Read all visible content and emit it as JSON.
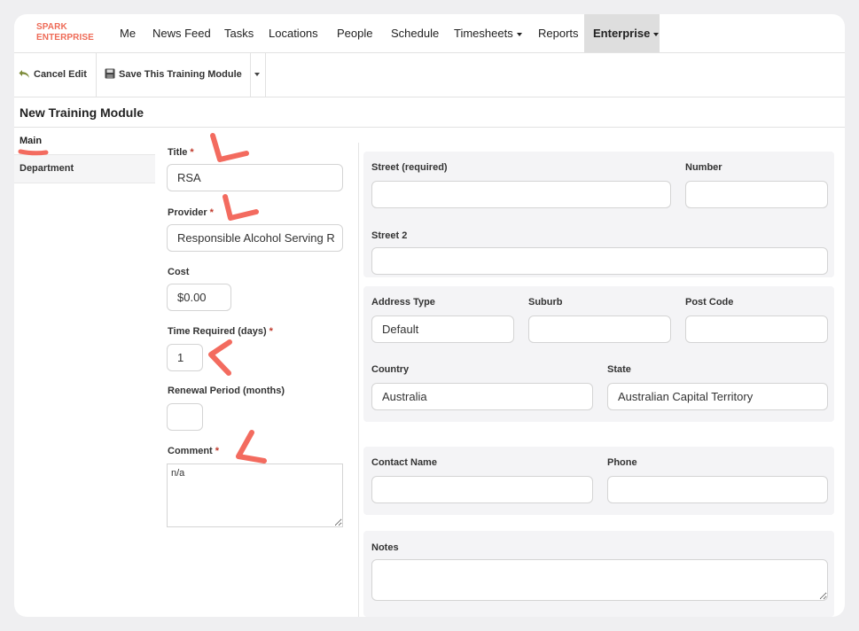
{
  "brand": {
    "line1": "SPARK",
    "line2": "ENTERPRISE"
  },
  "nav": {
    "me": "Me",
    "news_feed": "News Feed",
    "tasks": "Tasks",
    "locations": "Locations",
    "people": "People",
    "schedule": "Schedule",
    "timesheets": "Timesheets",
    "reports": "Reports",
    "enterprise": "Enterprise"
  },
  "toolbar": {
    "cancel_label": "Cancel Edit",
    "save_label": "Save This Training Module"
  },
  "page_title": "New Training Module",
  "sidebar": {
    "main": "Main",
    "department": "Department"
  },
  "form": {
    "title_label": "Title",
    "title_value": "RSA",
    "provider_label": "Provider",
    "provider_value": "Responsible Alcohol Serving R",
    "cost_label": "Cost",
    "cost_value": "$0.00",
    "time_label": "Time Required (days)",
    "time_value": "1",
    "renewal_label": "Renewal Period (months)",
    "renewal_value": "",
    "comment_label": "Comment",
    "comment_value": "n/a",
    "required_mark": "*"
  },
  "address": {
    "street_label": "Street (required)",
    "number_label": "Number",
    "street2_label": "Street 2",
    "address_type_label": "Address Type",
    "address_type_value": "Default",
    "suburb_label": "Suburb",
    "postcode_label": "Post Code",
    "country_label": "Country",
    "country_value": "Australia",
    "state_label": "State",
    "state_value": "Australian Capital Territory"
  },
  "contact": {
    "name_label": "Contact Name",
    "phone_label": "Phone",
    "notes_label": "Notes"
  },
  "colors": {
    "brand": "#ee6b57",
    "annotation": "#f36b5f",
    "required": "#c0392b",
    "active_nav": "#dedede"
  }
}
